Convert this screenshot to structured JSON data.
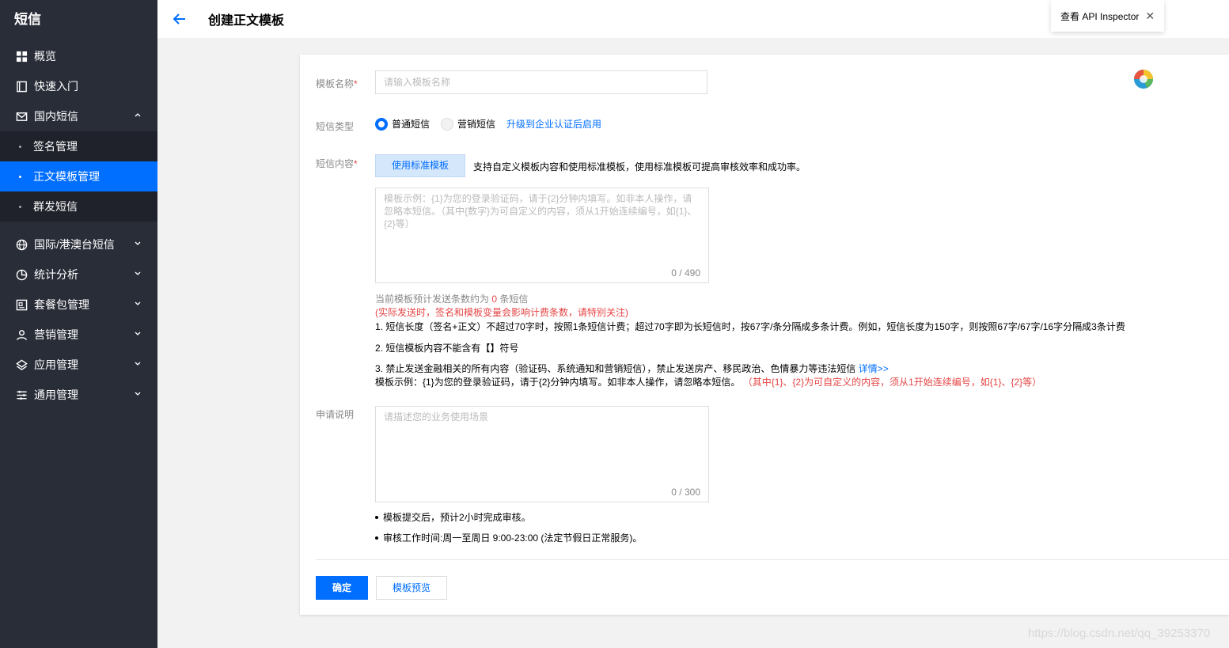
{
  "sidebar": {
    "title": "短信",
    "items": [
      {
        "label": "概览",
        "icon": "grid-icon"
      },
      {
        "label": "快速入门",
        "icon": "book-icon"
      },
      {
        "label": "国内短信",
        "icon": "mail-icon"
      }
    ],
    "sub_items": [
      {
        "label": "签名管理"
      },
      {
        "label": "正文模板管理"
      },
      {
        "label": "群发短信"
      }
    ],
    "more_items": [
      {
        "label": "国际/港澳台短信",
        "icon": "globe-icon"
      },
      {
        "label": "统计分析",
        "icon": "pie-chart-icon"
      },
      {
        "label": "套餐包管理",
        "icon": "package-icon"
      },
      {
        "label": "营销管理",
        "icon": "user-icon"
      },
      {
        "label": "应用管理",
        "icon": "layers-icon"
      },
      {
        "label": "通用管理",
        "icon": "sliders-icon"
      }
    ],
    "active_color": "#006eff"
  },
  "header": {
    "title": "创建正文模板",
    "api_inspector": "查看 API Inspector",
    "close_glyph": "✕"
  },
  "form": {
    "name_label": "模板名称",
    "name_placeholder": "请输入模板名称",
    "type_label": "短信类型",
    "type_options": [
      "普通短信",
      "营销短信"
    ],
    "type_selected": "普通短信",
    "upgrade_link": "升级到企业认证后启用",
    "content_label": "短信内容",
    "std_template_button": "使用标准模板",
    "std_template_tip": "支持自定义模板内容和使用标准模板，使用标准模板可提高审核效率和成功率。",
    "content_placeholder": "模板示例：{1}为您的登录验证码，请于{2}分钟内填写。如非本人操作，请忽略本短信。（其中{数字}为可自定义的内容，须从1开始连续编号，如{1}、{2}等）",
    "content_counter": "0 / 490",
    "estimate_prefix": "当前模板预计发送条数约为",
    "estimate_count": "0",
    "estimate_suffix": "条短信",
    "estimate_note": "(实际发送时，签名和模板变量会影响计费条数，请特别关注)",
    "rule1": "1. 短信长度（签名+正文）不超过70字时，按照1条短信计费；超过70字即为长短信时，按67字/条分隔成多条计费。例如，短信长度为150字，则按照67字/67字/16字分隔成3条计费",
    "rule2": "2. 短信模板内容不能含有【】符号",
    "rule3": "3. 禁止发送金融相关的所有内容（验证码、系统通知和营销短信），禁止发送房产、移民政治、色情暴力等违法短信",
    "rule3_link": "详情>>",
    "example_text": "模板示例：{1}为您的登录验证码，请于{2}分钟内填写。如非本人操作，请忽略本短信。",
    "example_note": "（其中{1}、{2}为可自定义的内容，须从1开始连续编号，如{1}、{2}等）",
    "apply_label": "申请说明",
    "apply_placeholder": "请描述您的业务使用场景",
    "apply_counter": "0 / 300",
    "note1": "模板提交后，预计2小时完成审核。",
    "note2": "审核工作时间:周一至周日 9:00-23:00 (法定节假日正常服务)。",
    "confirm_button": "确定",
    "preview_button": "模板预览",
    "required_mark": "*"
  },
  "watermark": "https://blog.csdn.net/qq_39253370"
}
